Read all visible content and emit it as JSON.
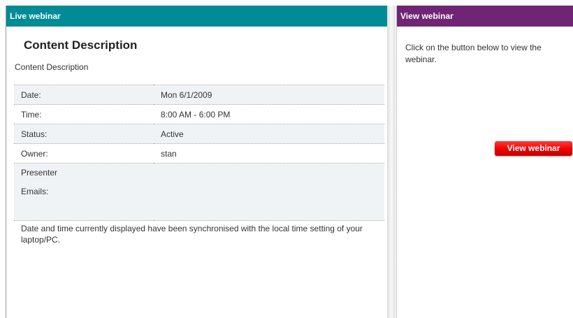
{
  "live_panel": {
    "header": "Live webinar",
    "title": "Content Description",
    "description": "Content Description",
    "details": {
      "date_label": "Date:",
      "date_value": "Mon 6/1/2009",
      "time_label": "Time:",
      "time_value": "8:00 AM - 6:00 PM",
      "status_label": "Status:",
      "status_value": "Active",
      "owner_label": "Owner:",
      "owner_value": "stan",
      "presenter_label_1": "Presenter",
      "presenter_label_2": "Emails:",
      "presenter_value": ""
    },
    "note": "Date and time currently displayed have been synchronised with the local time setting of your laptop/PC."
  },
  "view_panel": {
    "header": "View webinar",
    "instruction": "Click on the button below to view the webinar.",
    "button_label": "View webinar"
  },
  "colors": {
    "live_header": "#008b96",
    "view_header": "#702574",
    "button": "#ee0000"
  }
}
